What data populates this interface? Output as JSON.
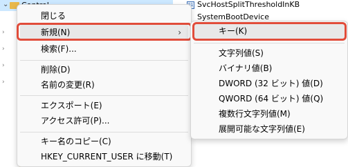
{
  "tree": {
    "selected_key": "Control"
  },
  "values": {
    "rows": [
      {
        "name": "SvcHostSplitThresholdInKB"
      },
      {
        "name": "SystemBootDevice"
      }
    ]
  },
  "context_menu": {
    "items": {
      "collapse": "閉じる",
      "new": "新規(N)",
      "find": "検索(F)...",
      "delete": "削除(D)",
      "rename": "名前の変更(R)",
      "export": "エクスポート(E)",
      "permissions": "アクセス許可(P)...",
      "copy_key_name": "キー名のコピー(C)",
      "goto_hkcu": "HKEY_CURRENT_USER に移動(T)"
    },
    "submenu_chevron": "›"
  },
  "new_submenu": {
    "items": {
      "key": "キー(K)",
      "string": "文字列値(S)",
      "binary": "バイナリ値(B)",
      "dword": "DWORD (32 ビット) 値(D)",
      "qword": "QWORD (64 ビット) 値(Q)",
      "multi_string": "複数行文字列値(M)",
      "expandable_string": "展開可能な文字列値(E)"
    }
  },
  "colors": {
    "highlight_box": "#e14c3a",
    "selection": "#cce8ff",
    "folder": "#e8b84a"
  }
}
